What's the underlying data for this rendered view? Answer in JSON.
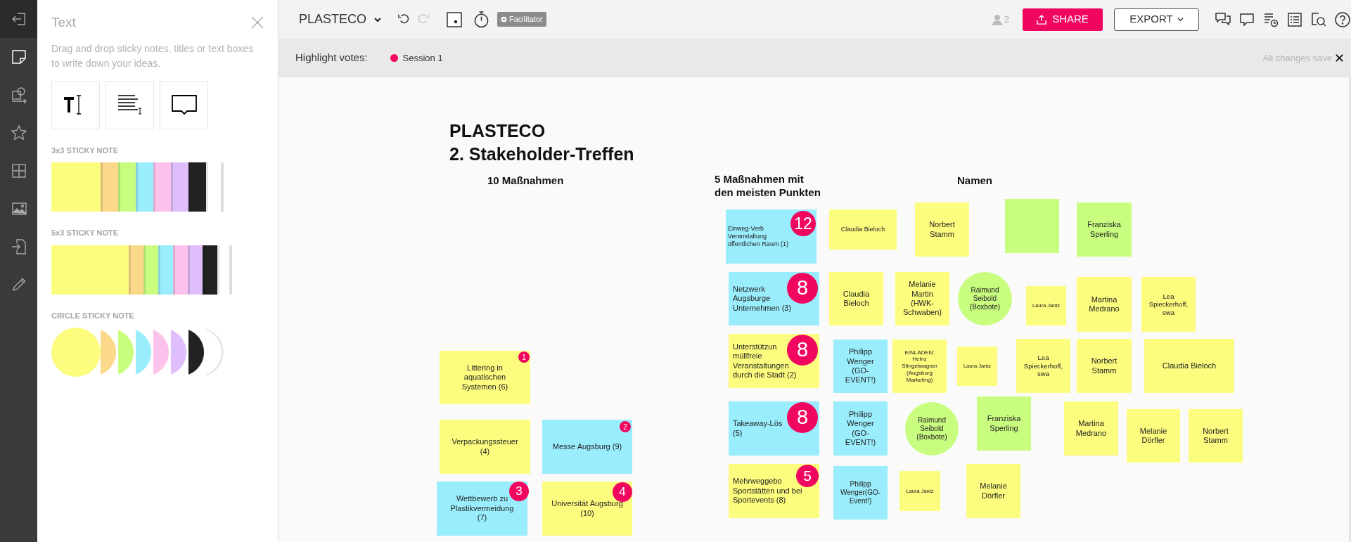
{
  "rail": {
    "items": [
      {
        "kind": "exit",
        "selected": false
      },
      {
        "kind": "sticky",
        "selected": true
      },
      {
        "kind": "shapes",
        "selected": false
      },
      {
        "kind": "star",
        "selected": false
      },
      {
        "kind": "grid",
        "selected": false
      },
      {
        "kind": "image",
        "selected": false
      },
      {
        "kind": "import",
        "selected": false
      },
      {
        "kind": "pencil",
        "selected": false
      }
    ]
  },
  "panel": {
    "title": "Text",
    "description": "Drag and drop sticky notes, titles or text boxes to write down your ideas.",
    "tools": [
      {
        "kind": "title"
      },
      {
        "kind": "paragraph"
      },
      {
        "kind": "callout"
      }
    ],
    "palettes": [
      {
        "label": "3x3 STICKY NOTE",
        "kind": "square",
        "swatches": [
          {
            "color": "#fcfc7f"
          },
          {
            "color": "#fcd98a"
          },
          {
            "color": "#c8fd80"
          },
          {
            "color": "#9aedfc"
          },
          {
            "color": "#fdc2eb"
          },
          {
            "color": "#dfbffb"
          },
          {
            "color": "#222222"
          },
          {
            "color": "#ffffff"
          }
        ]
      },
      {
        "label": "5x3 STICKY NOTE",
        "kind": "wide",
        "swatches": [
          {
            "color": "#fcfc7f"
          },
          {
            "color": "#fcd98a"
          },
          {
            "color": "#c8fd80"
          },
          {
            "color": "#9aedfc"
          },
          {
            "color": "#fdc2eb"
          },
          {
            "color": "#dfbffb"
          },
          {
            "color": "#222222"
          },
          {
            "color": "#ffffff"
          }
        ]
      },
      {
        "label": "CIRCLE STICKY NOTE",
        "kind": "circle",
        "swatches": [
          {
            "color": "#fcfc7f"
          },
          {
            "color": "#fcd98a"
          },
          {
            "color": "#c8fd80"
          },
          {
            "color": "#9aedfc"
          },
          {
            "color": "#fdc2eb"
          },
          {
            "color": "#dfbffb"
          },
          {
            "color": "#222222"
          },
          {
            "color": "#ffffff"
          }
        ]
      }
    ]
  },
  "header": {
    "board_title": "PLASTECO",
    "history": [
      {
        "kind": "undo",
        "disabled": false
      },
      {
        "kind": "redo",
        "disabled": true
      }
    ],
    "role": "Facilitator",
    "participants": "2",
    "share": "SHARE",
    "export": "EXPORT"
  },
  "highlight": {
    "label": "Highlight votes:",
    "sessions": [
      {
        "name": "Session 1",
        "color": "#f0065f"
      }
    ],
    "save_status": "All changes save"
  },
  "canvas": {
    "headings": [
      {
        "text": "PLASTECO",
        "kind": "title"
      },
      {
        "text": "2. Stakeholder-Treffen",
        "kind": "title"
      },
      {
        "text": "10 Maßnahmen",
        "kind": "column"
      },
      {
        "text": "5 Maßnahmen mit\nden meisten Punkten",
        "kind": "column"
      },
      {
        "text": "Namen",
        "kind": "column"
      }
    ],
    "notes": [
      {
        "text": "Littering in\naquatischen\nSystemen (6)",
        "color": "#fcfc7f",
        "kind": "square",
        "votes": "1"
      },
      {
        "text": "Verpackungssteuer\n(4)",
        "color": "#fcfc7f",
        "kind": "square"
      },
      {
        "text": "Messe Augsburg (9)",
        "color": "#9aedfc",
        "kind": "square",
        "votes": "2"
      },
      {
        "text": "Wettbewerb zu\nPlastikvermeidung\n(7)",
        "color": "#9aedfc",
        "kind": "square",
        "votes": "3"
      },
      {
        "text": "Universität Augsburg\n(10)",
        "color": "#fcfc7f",
        "kind": "square",
        "votes": "4"
      },
      {
        "text": "Einweg-Verb\nVeranstaltung\nöffentlichen Raum (1)",
        "color": "#9aedfc",
        "kind": "square",
        "votes": "12"
      },
      {
        "text": "Claudia Bieloch",
        "color": "#fcfc7f",
        "kind": "square"
      },
      {
        "text": "Norbert\nStamm",
        "color": "#fcfc7f",
        "kind": "square"
      },
      {
        "color": "#c8fd80",
        "kind": "square"
      },
      {
        "text": "Franziska\nSperling",
        "color": "#c8fd80",
        "kind": "square"
      },
      {
        "text": "Netzwerk\nAugsburge\nUnternehmen (3)",
        "color": "#9aedfc",
        "kind": "square",
        "votes": "8"
      },
      {
        "text": "Claudia\nBieloch",
        "color": "#fcfc7f",
        "kind": "square"
      },
      {
        "text": "Melanie\nMartin\n(HWK-\nSchwaben)",
        "color": "#fcfc7f",
        "kind": "square"
      },
      {
        "text": "Raimund\nSeibold\n(Boxbote)",
        "color": "#c8fd80",
        "kind": "circle"
      },
      {
        "text": "Laura Jantz",
        "color": "#fcfc7f",
        "kind": "square"
      },
      {
        "text": "Martina\nMedrano",
        "color": "#fcfc7f",
        "kind": "square"
      },
      {
        "text": "Lea\nSpieckerhoff,\nswa",
        "color": "#fcfc7f",
        "kind": "square"
      },
      {
        "text": "Unterstützun\nmüllfreie\nVeranstaltungen\ndurch die Stadt (2)",
        "color": "#fcfc7f",
        "kind": "square",
        "votes": "8"
      },
      {
        "text": "Philipp\nWenger\n(GO-\nEVENT!)",
        "color": "#9aedfc",
        "kind": "square"
      },
      {
        "text": "EINLADEN:\nHeinz\nStingelwagner\n(Augsburg\nMarketing)",
        "color": "#fcfc7f",
        "kind": "square"
      },
      {
        "text": "Laura Jantz",
        "color": "#fcfc7f",
        "kind": "square"
      },
      {
        "text": "Lea\nSpieckerhoff,\nswa",
        "color": "#fcfc7f",
        "kind": "square"
      },
      {
        "text": "Norbert\nStamm",
        "color": "#fcfc7f",
        "kind": "square"
      },
      {
        "text": "Claudia Bieloch",
        "color": "#fcfc7f",
        "kind": "square"
      },
      {
        "text": "Takeaway-Lös\n(5)",
        "color": "#9aedfc",
        "kind": "square",
        "votes": "8"
      },
      {
        "text": "Philipp\nWenger\n(GO-\nEVENT!)",
        "color": "#9aedfc",
        "kind": "square"
      },
      {
        "text": "Raimund\nSeibold\n(Boxbote)",
        "color": "#c8fd80",
        "kind": "circle"
      },
      {
        "text": "Franziska\nSperling",
        "color": "#c8fd80",
        "kind": "square"
      },
      {
        "text": "Martina\nMedrano",
        "color": "#fcfc7f",
        "kind": "square"
      },
      {
        "text": "Melanie\nDörfler",
        "color": "#fcfc7f",
        "kind": "square"
      },
      {
        "text": "Norbert\nStamm",
        "color": "#fcfc7f",
        "kind": "square"
      },
      {
        "text": "Mehrweggebo\nSportstätten und bei\nSportevents (8)",
        "color": "#fcfc7f",
        "kind": "square",
        "votes": "5"
      },
      {
        "text": "Philipp\nWenger(GO-\nEvent!)",
        "color": "#9aedfc",
        "kind": "square"
      },
      {
        "text": "Laura Jantz",
        "color": "#fcfc7f",
        "kind": "square"
      },
      {
        "text": "Melanie\nDörfler",
        "color": "#fcfc7f",
        "kind": "square"
      }
    ]
  }
}
